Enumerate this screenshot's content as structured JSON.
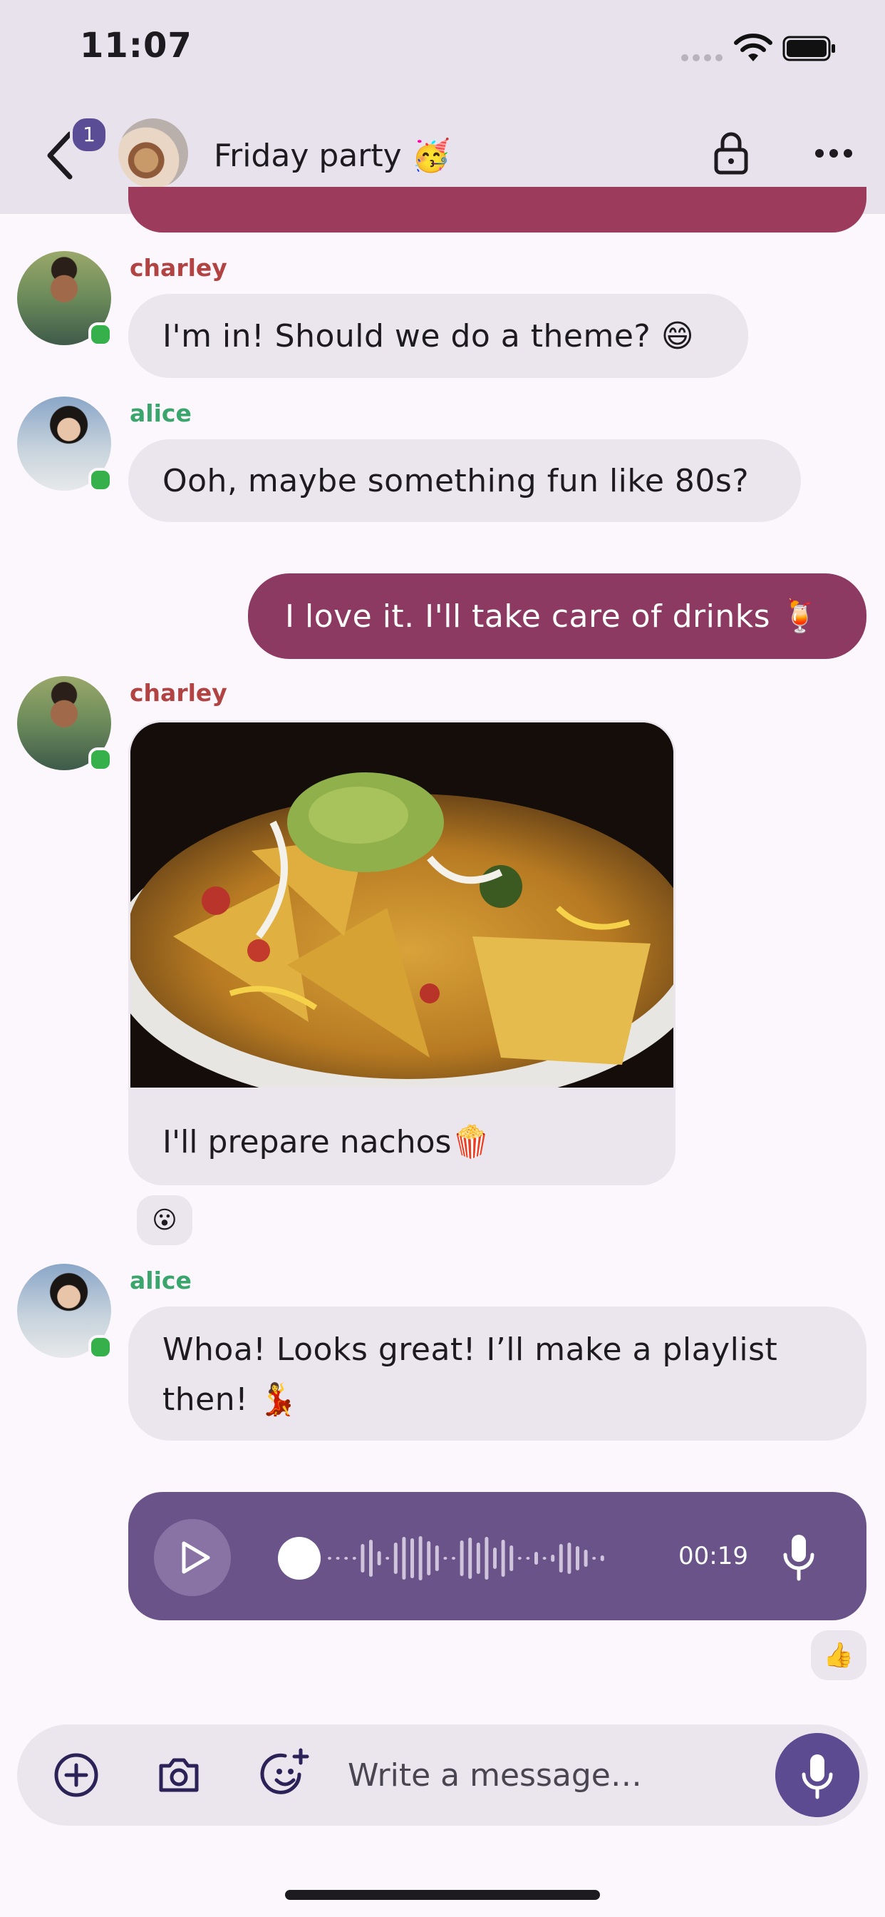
{
  "status_bar": {
    "time": "11:07"
  },
  "header": {
    "unread_count": "1",
    "chat_title": "Friday party 🥳"
  },
  "messages": [
    {
      "sender": "charley",
      "text": "I'm in! Should we do a theme? 😄"
    },
    {
      "sender": "alice",
      "text": "Ooh, maybe something fun like 80s?"
    },
    {
      "sender": "me",
      "text": "I love it. I'll take care of drinks 🍹"
    },
    {
      "sender": "charley",
      "caption": "I'll prepare nachos🍿",
      "reaction": "😮"
    },
    {
      "sender": "alice",
      "text_line1": "Whoa! Looks great! I’ll make a playlist",
      "text_line2": "then! 💃"
    },
    {
      "sender": "me",
      "voice_duration": "00:19",
      "voice_progress": 0.0,
      "reaction": "👍"
    }
  ],
  "composer": {
    "placeholder": "Write a message…"
  },
  "colors": {
    "header_bg": "#e8e2ec",
    "outgoing_bubble": "#8d3a62",
    "incoming_bubble": "#ebe6ed",
    "voice_bubble": "#6a5389",
    "accent": "#5d4b91",
    "online": "#35b04b",
    "charley_name": "#b14343",
    "alice_name": "#3aa56c"
  },
  "icons": [
    "back-arrow-icon",
    "lock-icon",
    "more-icon",
    "play-icon",
    "microphone-icon",
    "add-circle-icon",
    "camera-icon",
    "emoji-add-icon"
  ]
}
